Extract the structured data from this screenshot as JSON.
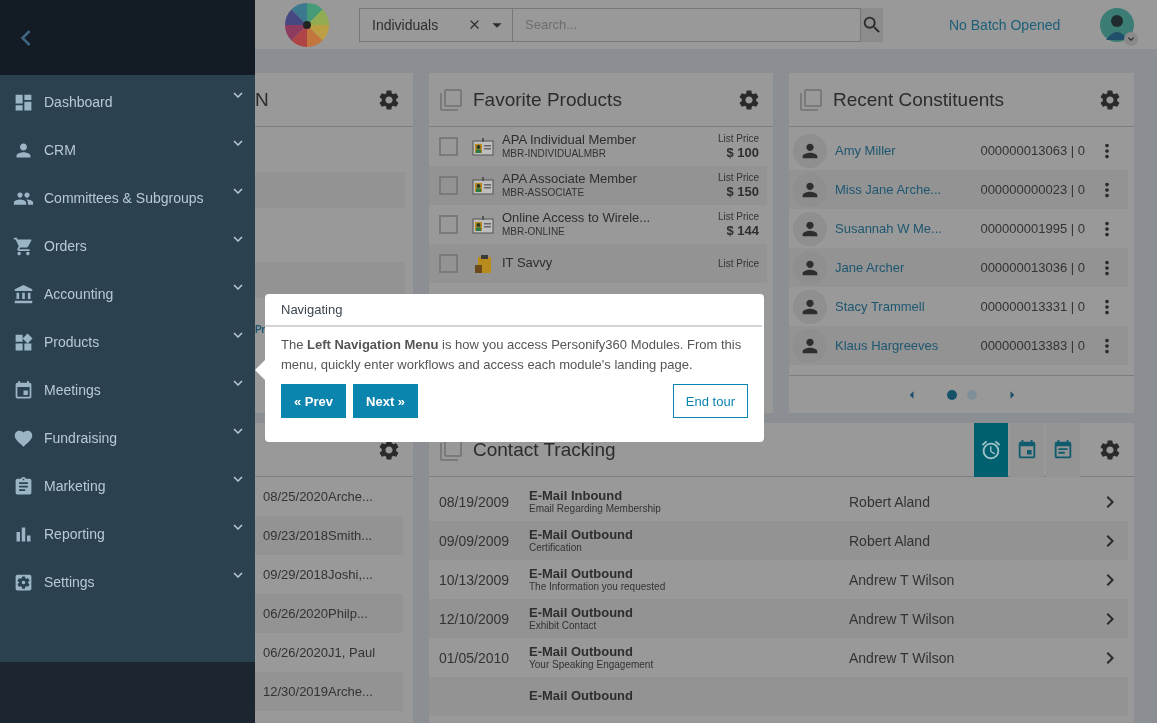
{
  "sidebar": {
    "items": [
      {
        "label": "Dashboard"
      },
      {
        "label": "CRM"
      },
      {
        "label": "Committees & Subgroups"
      },
      {
        "label": "Orders"
      },
      {
        "label": "Accounting"
      },
      {
        "label": "Products"
      },
      {
        "label": "Meetings"
      },
      {
        "label": "Fundraising"
      },
      {
        "label": "Marketing"
      },
      {
        "label": "Reporting"
      },
      {
        "label": "Settings"
      }
    ]
  },
  "header": {
    "search_type": "Individuals",
    "search": {
      "placeholder": "Search..."
    },
    "batch_status": "No Batch Opened"
  },
  "left_top_card": {
    "title": "N",
    "link": "Pr"
  },
  "favorite_products": {
    "title": "Favorite Products",
    "items": [
      {
        "kind": "membership",
        "checked": false,
        "name": "APA Individual Member",
        "code": "MBR-INDIVIDUALMBR",
        "price_label": "List Price",
        "price": "$ 100"
      },
      {
        "kind": "membership",
        "checked": false,
        "name": "APA Associate Member",
        "code": "MBR-ASSOCIATE",
        "price_label": "List Price",
        "price": "$ 150"
      },
      {
        "kind": "membership",
        "checked": false,
        "name": "Online Access to Wirele...",
        "code": "MBR-ONLINE",
        "price_label": "List Price",
        "price": "$ 144"
      },
      {
        "kind": "product",
        "checked": false,
        "name": "IT Savvy",
        "price_label": "List Price"
      }
    ]
  },
  "recent_constituents": {
    "title": "Recent Constituents",
    "rows": [
      {
        "name": "Amy Miller",
        "id": "000000013063 | 0"
      },
      {
        "name": "Miss Jane Arche...",
        "id": "000000000023 | 0"
      },
      {
        "name": "Susannah W Me...",
        "id": "000000001995 | 0"
      },
      {
        "name": "Jane Archer",
        "id": "000000013036 | 0"
      },
      {
        "name": "Stacy Trammell",
        "id": "000000013331 | 0"
      },
      {
        "name": "Klaus Hargreeves",
        "id": "000000013383 | 0"
      }
    ],
    "pages": [
      {
        "selected": true
      },
      {
        "selected": false
      }
    ]
  },
  "left_bottom_card": {
    "rows": [
      {
        "date": "08/25/2020",
        "name": "Arche..."
      },
      {
        "date": "09/23/2018",
        "name": "Smith..."
      },
      {
        "date": "09/29/2018",
        "name": "Joshi,..."
      },
      {
        "date": "06/26/2020",
        "name": "Philp..."
      },
      {
        "date": "06/26/2020",
        "name": "J1, Paul"
      },
      {
        "date": "12/30/2019",
        "name": "Arche..."
      }
    ]
  },
  "contact_tracking": {
    "title": "Contact Tracking",
    "views": [
      {
        "selected": true
      },
      {
        "selected": false
      },
      {
        "selected": false
      }
    ],
    "rows": [
      {
        "date": "08/19/2009",
        "type": "E-Mail Inbound",
        "subject": "Email Regarding Membership",
        "person": "Robert Aland"
      },
      {
        "date": "09/09/2009",
        "type": "E-Mail Outbound",
        "subject": "Certification",
        "person": "Robert Aland"
      },
      {
        "date": "10/13/2009",
        "type": "E-Mail Outbound",
        "subject": "The Information you requested",
        "person": "Andrew T Wilson"
      },
      {
        "date": "12/10/2009",
        "type": "E-Mail Outbound",
        "subject": "Exhibit Contact",
        "person": "Andrew T Wilson"
      },
      {
        "date": "01/05/2010",
        "type": "E-Mail Outbound",
        "subject": "Your Speaking Engagement",
        "person": "Andrew T Wilson"
      },
      {
        "type": "E-Mail Outbound"
      }
    ]
  },
  "tour": {
    "title": "Navigating",
    "body": "The **Left Navigation Menu** is how you access Personify360 Modules. From this menu, quickly enter workflows and access each module's landing page.",
    "buttons": [
      {
        "kind": "primary",
        "label": "« Prev"
      },
      {
        "kind": "primary",
        "label": "Next »"
      },
      {
        "kind": "outline",
        "label": "End tour"
      }
    ]
  }
}
